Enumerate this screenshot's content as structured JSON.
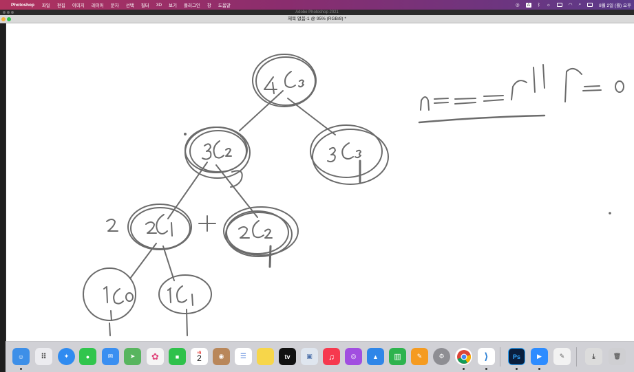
{
  "menubar": {
    "app_name": "Photoshop",
    "items": [
      "파일",
      "편집",
      "이미지",
      "레이어",
      "문자",
      "선택",
      "필터",
      "3D",
      "보기",
      "플러그인",
      "창",
      "도움말"
    ],
    "status": {
      "clock": "8월 2일 (월) 오후",
      "input_method": "A"
    }
  },
  "window": {
    "app_title": "Adobe Photoshop 2021",
    "document_title": "제목 없음-1 @ 95% (RGB/8) *"
  },
  "drawing": {
    "description_free": true
  },
  "dock": {
    "calendar_month": "8월",
    "calendar_day": "2",
    "apple_tv_label": "tv",
    "photoshop_label": "Ps",
    "apps": [
      {
        "name": "finder",
        "color": "#3d8fe8"
      },
      {
        "name": "launchpad",
        "color": "#e9e9ee"
      },
      {
        "name": "safari",
        "color": "#2f8bf0"
      },
      {
        "name": "messages",
        "color": "#31c54d"
      },
      {
        "name": "mail",
        "color": "#3a8ff1"
      },
      {
        "name": "maps",
        "color": "#58b55f"
      },
      {
        "name": "photos",
        "color": "#f5f5f5"
      },
      {
        "name": "facetime",
        "color": "#2fc14b"
      },
      {
        "name": "calendar",
        "color": "#ffffff"
      },
      {
        "name": "contacts",
        "color": "#b9875a"
      },
      {
        "name": "reminders",
        "color": "#ffffff"
      },
      {
        "name": "notes",
        "color": "#f7d64a"
      },
      {
        "name": "apple-tv",
        "color": "#111111"
      },
      {
        "name": "preview",
        "color": "#dfe6ef"
      },
      {
        "name": "music",
        "color": "#f6394e"
      },
      {
        "name": "podcasts",
        "color": "#a14ee0"
      },
      {
        "name": "keynote",
        "color": "#2f86e8"
      },
      {
        "name": "numbers",
        "color": "#2eb34e"
      },
      {
        "name": "pages",
        "color": "#f59b20"
      },
      {
        "name": "system-preferences",
        "color": "#8e8e93"
      },
      {
        "name": "chrome",
        "color": "#ffffff"
      },
      {
        "name": "vscode",
        "color": "#ffffff"
      },
      {
        "name": "photoshop",
        "color": "#0a1f3d"
      },
      {
        "name": "zoom",
        "color": "#2d8cff"
      },
      {
        "name": "textedit",
        "color": "#f2f2f2"
      },
      {
        "name": "downloads",
        "color": "#dcdcdc"
      },
      {
        "name": "trash",
        "color": "#cfcfd2"
      }
    ]
  }
}
